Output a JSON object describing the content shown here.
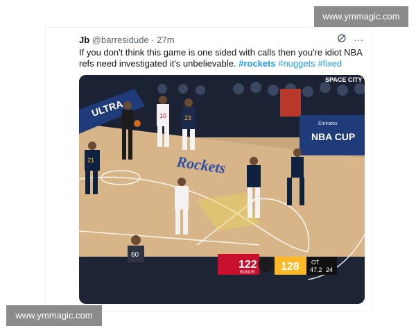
{
  "watermark": {
    "top": "www.ymmagic.com",
    "bottom": "www.ymmagic.com"
  },
  "tweet": {
    "name": "Jb",
    "handle": "@barresidude",
    "separator": "·",
    "time": "27m",
    "text_before": "If you don't think this game is one sided with calls then you're idiot NBA refs need investigated it's unbelievable. ",
    "hashtags": [
      "#rockets",
      "#nuggets",
      "#fixed"
    ],
    "actions": {
      "grok_icon": "grok-icon",
      "more_icon": "more-icon",
      "more_label": "···"
    }
  },
  "image": {
    "scoreboard": {
      "home_score": "122",
      "bonus_label": "BONUS",
      "away_score": "128",
      "period": "OT",
      "clock": "47.2",
      "shot_clock": "24"
    },
    "court_text": {
      "ultra": "ULTRA",
      "cup_brand": "Emirates",
      "cup_name": "NBA CUP",
      "space_city": "SPACE CITY",
      "center_word": "Rockets"
    },
    "jerseys": {
      "white_player_1": "10",
      "white_player_2": "23",
      "navy_player_1": "21",
      "referee": "60"
    },
    "colors": {
      "court": "#d8b589",
      "home": "#c8102e",
      "away_gold": "#fdb927",
      "nuggets_navy": "#0e2240"
    }
  }
}
